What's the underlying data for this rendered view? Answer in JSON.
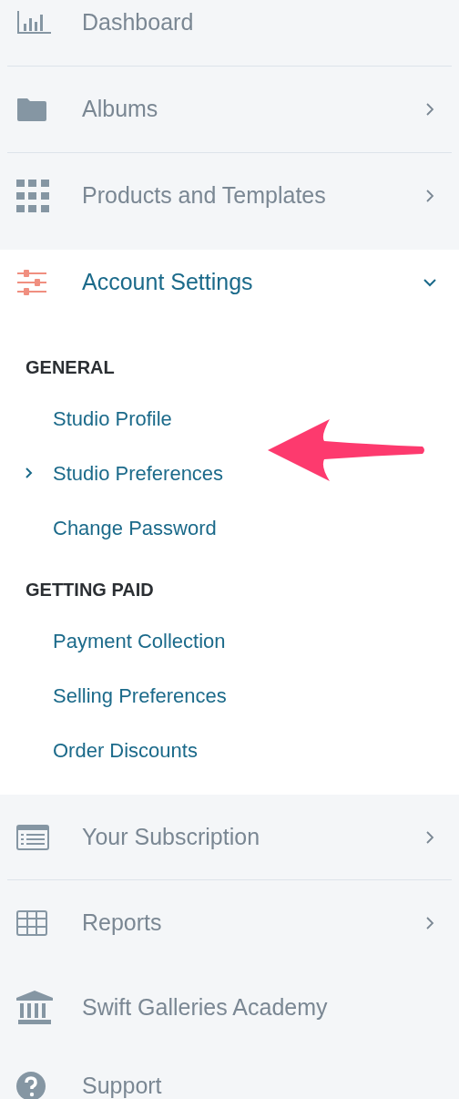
{
  "menu": [
    {
      "label": "Dashboard"
    },
    {
      "label": "Albums",
      "expanded": false
    },
    {
      "label": "Products and Templates",
      "expanded": false
    },
    {
      "label": "Account Settings",
      "expanded": true,
      "sections": [
        {
          "title": "GENERAL",
          "items": [
            {
              "label": "Studio Profile",
              "selected": false
            },
            {
              "label": "Studio Preferences",
              "selected": true
            },
            {
              "label": "Change Password",
              "selected": false
            }
          ]
        },
        {
          "title": "GETTING PAID",
          "items": [
            {
              "label": "Payment Collection",
              "selected": false
            },
            {
              "label": "Selling Preferences",
              "selected": false
            },
            {
              "label": "Order Discounts",
              "selected": false
            }
          ]
        }
      ]
    },
    {
      "label": "Your Subscription",
      "expanded": false
    },
    {
      "label": "Reports",
      "expanded": false
    },
    {
      "label": "Swift Galleries Academy"
    },
    {
      "label": "Support"
    }
  ]
}
